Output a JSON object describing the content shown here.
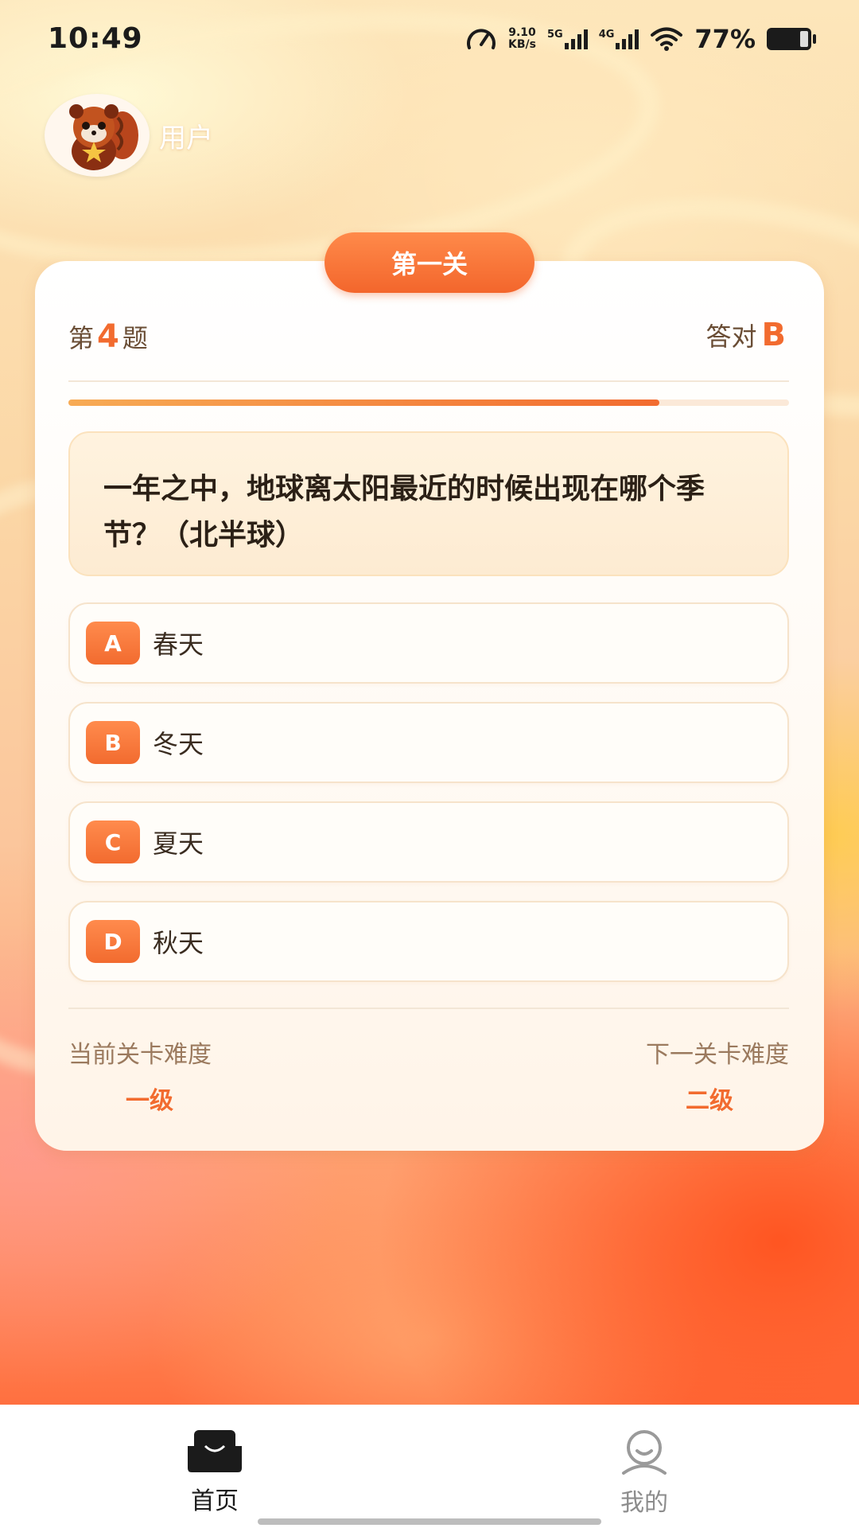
{
  "status_bar": {
    "time": "10:49",
    "net_speed_value": "9.10",
    "net_speed_unit": "KB/s",
    "sim1": "5G",
    "sim2": "4G",
    "battery": "77%"
  },
  "user": {
    "name": "用户"
  },
  "quiz": {
    "level_title": "第一关",
    "question_prefix": "第",
    "question_number": "4",
    "question_suffix": "题",
    "answer_label": "答对",
    "answer_value": "B",
    "progress": 0.82,
    "question_text": "一年之中，地球离太阳最近的时候出现在哪个季节？（北半球）",
    "options": [
      {
        "letter": "A",
        "text": "春天"
      },
      {
        "letter": "B",
        "text": "冬天"
      },
      {
        "letter": "C",
        "text": "夏天"
      },
      {
        "letter": "D",
        "text": "秋天"
      }
    ],
    "current_difficulty_label": "当前关卡难度",
    "current_difficulty_value": "一级",
    "next_difficulty_label": "下一关卡难度",
    "next_difficulty_value": "二级"
  },
  "tabs": [
    {
      "label": "首页",
      "icon": "home-icon",
      "active": true
    },
    {
      "label": "我的",
      "icon": "profile-icon",
      "active": false
    }
  ],
  "colors": {
    "accent": "#f26b2f",
    "accent_light": "#ff8b4d",
    "text_dark": "#2b2016",
    "text_muted": "#9b7a5e"
  }
}
